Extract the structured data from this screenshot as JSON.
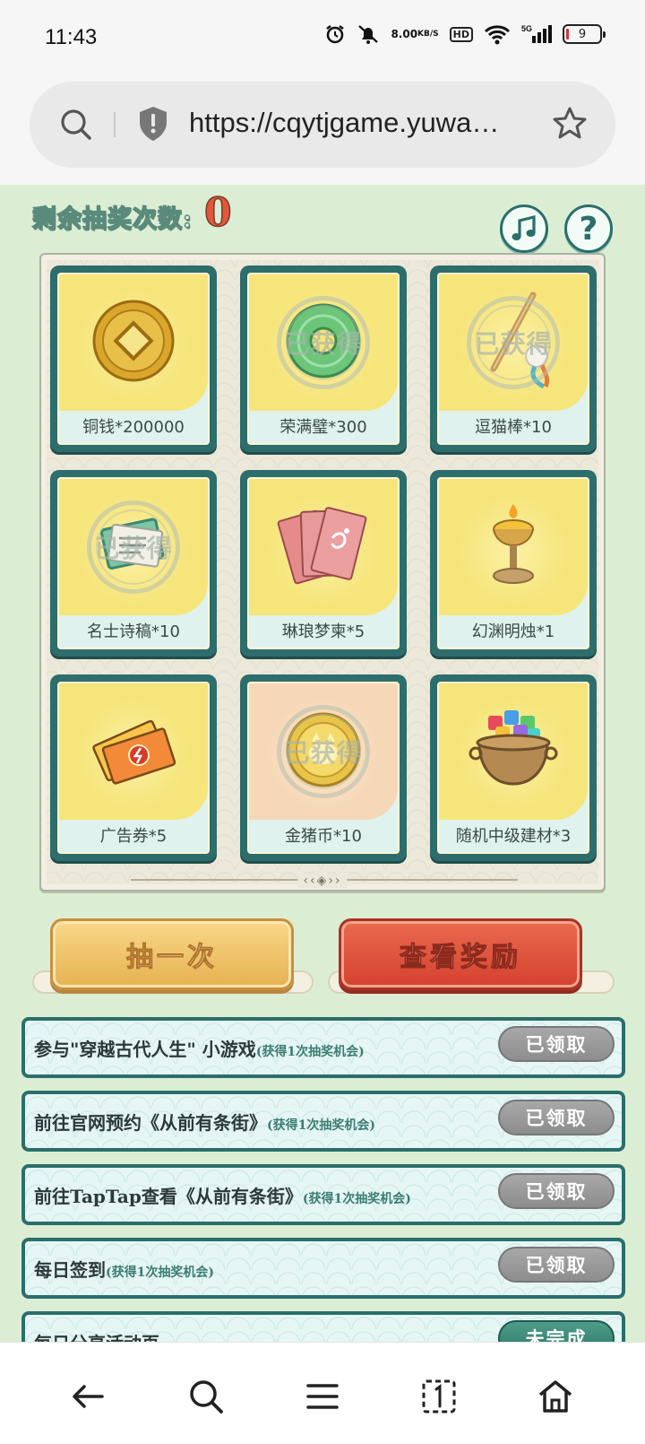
{
  "status_bar": {
    "time": "11:43",
    "network_speed_value": "8.00",
    "network_speed_unit": "KB/S",
    "hd_badge": "HD",
    "signal_label": "5G",
    "battery": "9"
  },
  "browser": {
    "url": "https://cqytjgame.yuwa…"
  },
  "game": {
    "remaining_label": "剩余抽奖次数:",
    "remaining_count": "0",
    "prizes": [
      {
        "label": "铜钱*200000",
        "claimed": false,
        "icon": "copper-coin-icon"
      },
      {
        "label": "荣满璧*300",
        "claimed": true,
        "icon": "jade-disc-icon"
      },
      {
        "label": "逗猫棒*10",
        "claimed": true,
        "icon": "cat-teaser-icon"
      },
      {
        "label": "名士诗稿*10",
        "claimed": true,
        "icon": "poetry-scroll-icon"
      },
      {
        "label": "琳琅梦柬*5",
        "claimed": false,
        "icon": "dream-letters-icon"
      },
      {
        "label": "幻渊明烛*1",
        "claimed": false,
        "icon": "candle-icon"
      },
      {
        "label": "广告券*5",
        "claimed": false,
        "icon": "ad-ticket-icon"
      },
      {
        "label": "金猪币*10",
        "claimed": true,
        "icon": "gold-pig-coin-icon"
      },
      {
        "label": "随机中级建材*3",
        "claimed": false,
        "icon": "material-pot-icon"
      }
    ],
    "stamp_text": "已获得",
    "board_ornament": "‹‹◈››",
    "draw_button": "抽一次",
    "view_rewards_button": "查看奖励",
    "tasks": [
      {
        "text": "参与\"穿越古代人生\" 小游戏",
        "note": "(获得1次抽奖机会)",
        "button": "已领取"
      },
      {
        "text": "前往官网预约《从前有条街》",
        "note": "(获得1次抽奖机会)",
        "button": "已领取"
      },
      {
        "text": "前往TapTap查看《从前有条街》",
        "note": "(获得1次抽奖机会)",
        "button": "已领取"
      },
      {
        "text": "每日签到",
        "note": "(获得1次抽奖机会)",
        "button": "已领取"
      },
      {
        "text": "每日分享活动页",
        "note": "",
        "button": "未完成"
      }
    ]
  },
  "colors": {
    "game_bg": "#dbeed3",
    "tile_frame": "#2d6d6b",
    "tile_face": "#f6e57a",
    "draw_button": "#e6b150",
    "view_button": "#d5412f",
    "claimed_button": "#8d8d8d"
  }
}
